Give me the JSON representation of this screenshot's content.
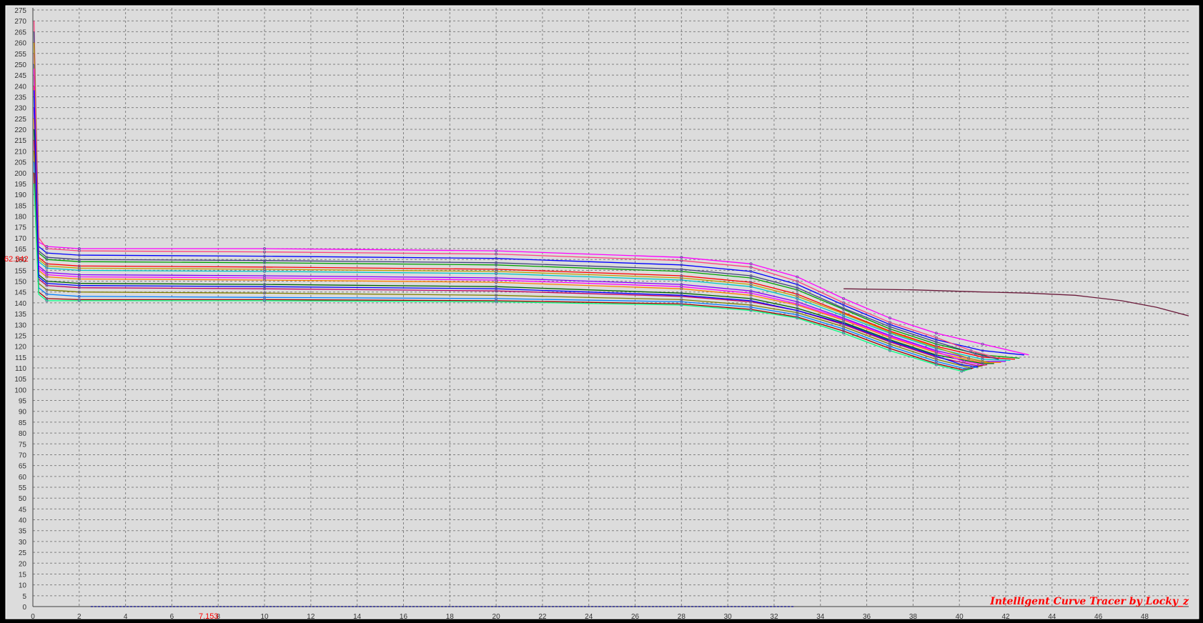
{
  "watermark": "Intelligent Curve Tracer by Locky_z",
  "cursor": {
    "x_readout": "7.153",
    "y_readout": "62.342"
  },
  "chart_data": {
    "type": "line",
    "title": "",
    "xlabel": "",
    "ylabel": "",
    "xlim": [
      0,
      49.9
    ],
    "ylim": [
      0,
      276
    ],
    "x_ticks": [
      0,
      2,
      4,
      6,
      8,
      10,
      12,
      14,
      16,
      18,
      20,
      22,
      24,
      26,
      28,
      30,
      32,
      34,
      36,
      38,
      40,
      42,
      44,
      46,
      48
    ],
    "y_ticks": [
      0,
      5,
      10,
      15,
      20,
      25,
      30,
      35,
      40,
      45,
      50,
      55,
      60,
      65,
      70,
      75,
      80,
      85,
      90,
      95,
      100,
      105,
      110,
      115,
      120,
      125,
      130,
      135,
      140,
      145,
      150,
      155,
      160,
      165,
      170,
      175,
      180,
      185,
      190,
      195,
      200,
      205,
      210,
      215,
      220,
      225,
      230,
      235,
      240,
      245,
      250,
      255,
      260,
      265,
      270,
      275
    ],
    "grid": true,
    "legend": "none",
    "colors": {
      "plot_background": "#dcdcdc",
      "frame_background": "#000000",
      "gridline": "#808080",
      "cursor_text": "#ff0000",
      "series_palette": [
        "#ff00ff",
        "#0000ff",
        "#00a000",
        "#ff0000",
        "#00c8c8",
        "#8000ff",
        "#ff8000",
        "#006400",
        "#c00060",
        "#808000",
        "#0080ff",
        "#a00000",
        "#00ff80",
        "#ff4080",
        "#404080",
        "#c0a000"
      ]
    },
    "series": [
      {
        "x": [
          0.05,
          0.25,
          0.6,
          2,
          10,
          20,
          28,
          31,
          33,
          35,
          37,
          39,
          41,
          43
        ],
        "y": [
          255,
          168,
          166,
          165,
          165,
          164,
          161,
          158,
          152,
          142,
          133,
          126,
          121,
          116
        ]
      },
      {
        "x": [
          0.05,
          0.25,
          0.6,
          2,
          10,
          20,
          28,
          31,
          33,
          35,
          37,
          39,
          41,
          42.8
        ],
        "y": [
          250,
          166,
          163,
          162,
          161.5,
          160.5,
          157.5,
          154.5,
          148.5,
          139,
          130,
          123,
          118,
          116
        ]
      },
      {
        "x": [
          0.05,
          0.25,
          0.6,
          2,
          10,
          20,
          28,
          31,
          33,
          35,
          37,
          39,
          41,
          42.6
        ],
        "y": [
          245,
          163,
          160,
          159,
          158.5,
          157.5,
          154.5,
          151.5,
          146,
          137,
          128,
          121,
          116,
          114.5
        ]
      },
      {
        "x": [
          0.05,
          0.25,
          0.6,
          2,
          10,
          20,
          28,
          31,
          33,
          35,
          37,
          39,
          41,
          42.4
        ],
        "y": [
          240,
          161,
          158,
          157,
          156.5,
          155.5,
          152.5,
          149.5,
          144,
          135.5,
          127,
          120,
          115,
          114
        ]
      },
      {
        "x": [
          0.05,
          0.25,
          0.6,
          2,
          10,
          20,
          28,
          31,
          33,
          35,
          37,
          39,
          41,
          42.2
        ],
        "y": [
          235,
          159,
          156,
          155,
          154.5,
          153.5,
          150.5,
          147.5,
          142,
          134,
          126,
          119,
          114,
          113.5
        ]
      },
      {
        "x": [
          0.05,
          0.25,
          0.6,
          2,
          10,
          20,
          28,
          31,
          33,
          35,
          37,
          39,
          41,
          42
        ],
        "y": [
          230,
          157,
          154,
          153,
          152.5,
          151.5,
          148.5,
          145.5,
          140.5,
          133,
          125,
          118,
          113,
          113
        ]
      },
      {
        "x": [
          0.05,
          0.25,
          0.6,
          2,
          10,
          20,
          28,
          31,
          33,
          35,
          37,
          39,
          41,
          41.8
        ],
        "y": [
          225,
          155,
          152,
          151,
          150.5,
          149.5,
          146.5,
          143.5,
          139,
          132,
          124,
          117,
          112.5,
          112.5
        ]
      },
      {
        "x": [
          0.05,
          0.25,
          0.6,
          2,
          10,
          20,
          28,
          31,
          33,
          35,
          37,
          39,
          41,
          41.5
        ],
        "y": [
          220,
          153,
          150,
          149,
          148.5,
          147.5,
          144.5,
          142,
          137.5,
          131,
          123,
          116,
          112,
          112
        ]
      },
      {
        "x": [
          0.05,
          0.25,
          0.6,
          2,
          10,
          20,
          28,
          31,
          33,
          35,
          37,
          39,
          40.8,
          41.2
        ],
        "y": [
          215,
          151,
          148,
          147,
          146.5,
          145.5,
          143,
          140.5,
          136.5,
          130,
          122,
          115,
          111,
          111.5
        ]
      },
      {
        "x": [
          0.05,
          0.25,
          0.6,
          2,
          10,
          20,
          28,
          31,
          33,
          35,
          37,
          39,
          40.5,
          41
        ],
        "y": [
          210,
          149,
          146,
          145,
          144.5,
          143.5,
          141.5,
          139,
          135.5,
          129,
          121,
          114,
          110,
          111
        ]
      },
      {
        "x": [
          0.05,
          0.25,
          0.6,
          2,
          10,
          20,
          28,
          31,
          33,
          35,
          37,
          39,
          40.3,
          40.8
        ],
        "y": [
          205,
          147,
          144,
          143,
          142.5,
          142,
          140.5,
          138,
          134.5,
          128,
          120,
          113,
          109.5,
          110.5
        ]
      },
      {
        "x": [
          0.05,
          0.25,
          0.6,
          2,
          10,
          20,
          28,
          31,
          33,
          35,
          37,
          39,
          40.2,
          40.6
        ],
        "y": [
          200,
          145,
          142,
          141.5,
          141.5,
          141,
          139.5,
          137,
          133.5,
          127,
          119,
          112,
          109,
          110
        ]
      },
      {
        "x": [
          0.05,
          0.25,
          0.6,
          2,
          10,
          20,
          28,
          31,
          33,
          35,
          37,
          39,
          40.1,
          40.5
        ],
        "y": [
          195,
          144,
          141,
          141,
          141,
          140.5,
          139,
          136.5,
          133,
          126,
          118,
          111.5,
          108.5,
          109.5
        ]
      },
      {
        "x": [
          0.05,
          0.25,
          0.6,
          2,
          10,
          20,
          28,
          31,
          33,
          35,
          37,
          39,
          40.5,
          41.5
        ],
        "y": [
          270,
          170,
          165,
          164,
          163.5,
          162.5,
          159.5,
          156.5,
          150,
          140,
          131,
          124,
          118,
          115
        ]
      },
      {
        "x": [
          0.05,
          0.25,
          0.6,
          2,
          10,
          20,
          28,
          31,
          33,
          35,
          37,
          39,
          40.7,
          41.7
        ],
        "y": [
          265,
          164,
          161,
          160,
          159.5,
          158.5,
          155.5,
          152.5,
          147,
          137.5,
          129,
          122,
          116.5,
          114
        ]
      },
      {
        "x": [
          0.05,
          0.25,
          0.6,
          2,
          10,
          20,
          28,
          31,
          33,
          35,
          37,
          39,
          40.4,
          41.3
        ],
        "y": [
          260,
          160,
          157,
          156,
          155.5,
          154.5,
          151.5,
          148.5,
          143,
          135,
          126.5,
          119.5,
          114.5,
          112.5
        ]
      },
      {
        "x": [
          0.05,
          0.25,
          0.6,
          2,
          10,
          20,
          28,
          31,
          33,
          35,
          37,
          39,
          40.2,
          41
        ],
        "y": [
          248,
          156,
          153,
          152,
          151.5,
          150.5,
          147.5,
          144.5,
          139.5,
          132.5,
          124.5,
          117.5,
          113,
          111.5
        ]
      },
      {
        "x": [
          0.05,
          0.25,
          0.6,
          2,
          10,
          20,
          28,
          31,
          33,
          35,
          37,
          39,
          40.1,
          40.8
        ],
        "y": [
          238,
          152,
          149,
          148,
          147.5,
          146.5,
          143.5,
          141,
          136.5,
          130.5,
          122.5,
          115.5,
          111.5,
          110.5
        ]
      },
      {
        "x": [
          35,
          38,
          41,
          43,
          45,
          47,
          48.5,
          49.9
        ],
        "y": [
          146.5,
          146,
          145,
          144.5,
          143.5,
          141,
          138,
          134
        ]
      }
    ]
  }
}
